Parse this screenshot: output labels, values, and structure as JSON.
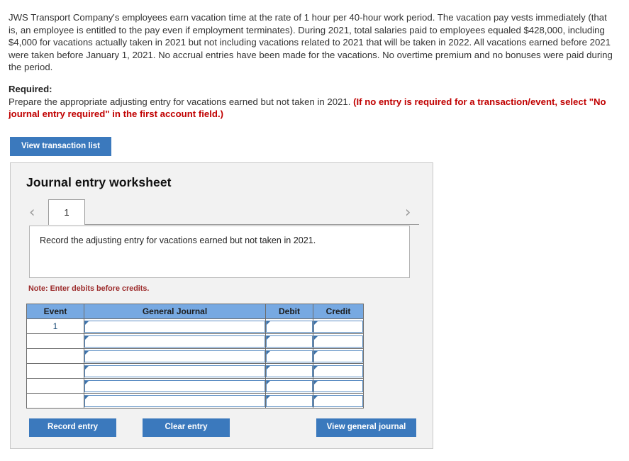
{
  "problem": {
    "statement": "JWS Transport Company's employees earn vacation time at the rate of 1 hour per 40-hour work period. The vacation pay vests immediately (that is, an employee is entitled to the pay even if employment terminates). During 2021, total salaries paid to employees equaled $428,000, including $4,000 for vacations actually taken in 2021 but not including vacations related to 2021 that will be taken in 2022. All vacations earned before 2021 were taken before January 1, 2021. No accrual entries have been made for the vacations. No overtime premium and no bonuses were paid during the period."
  },
  "required": {
    "label": "Required:",
    "instruction": "Prepare the appropriate adjusting entry for vacations earned but not taken in 2021.",
    "emphasis": "(If no entry is required for a transaction/event, select \"No journal entry required\" in the first account field.)"
  },
  "toolbar": {
    "view_transaction_list_label": "View transaction list"
  },
  "worksheet": {
    "title": "Journal entry worksheet",
    "prev_icon": "‹",
    "next_icon": "›",
    "tabs": [
      {
        "label": "1",
        "active": true
      }
    ],
    "instruction": "Record the adjusting entry for vacations earned but not taken in 2021.",
    "note": "Note: Enter debits before credits.",
    "table": {
      "headers": [
        "Event",
        "General Journal",
        "Debit",
        "Credit"
      ],
      "rows": [
        {
          "event": "1",
          "general_journal": "",
          "debit": "",
          "credit": ""
        },
        {
          "event": "",
          "general_journal": "",
          "debit": "",
          "credit": ""
        },
        {
          "event": "",
          "general_journal": "",
          "debit": "",
          "credit": ""
        },
        {
          "event": "",
          "general_journal": "",
          "debit": "",
          "credit": ""
        },
        {
          "event": "",
          "general_journal": "",
          "debit": "",
          "credit": ""
        },
        {
          "event": "",
          "general_journal": "",
          "debit": "",
          "credit": ""
        }
      ]
    },
    "actions": {
      "record_entry_label": "Record entry",
      "clear_entry_label": "Clear entry",
      "view_general_journal_label": "View general journal"
    }
  },
  "colors": {
    "primary_button": "#3b79bd",
    "table_header": "#77a9e2",
    "panel_background": "#f2f2f2",
    "note_red": "#9c2b2b",
    "emphasis_red": "#c00000",
    "field_border": "#5d8fc4"
  }
}
